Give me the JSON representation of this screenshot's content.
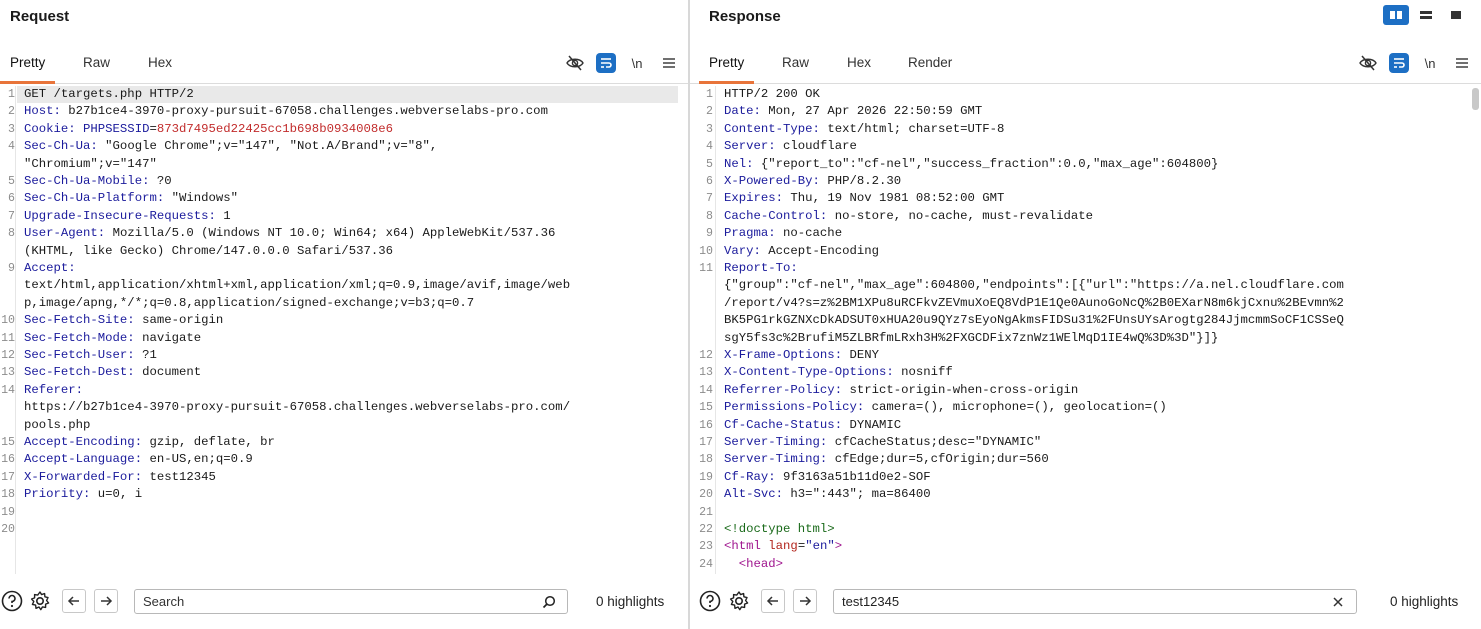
{
  "request": {
    "title": "Request",
    "tabs": [
      "Pretty",
      "Raw",
      "Hex"
    ],
    "tools": {
      "newline": "\\n"
    },
    "lines": [
      {
        "n": "1",
        "parts": [
          {
            "t": "GET /targets.php HTTP/2",
            "c": "hval"
          }
        ]
      },
      {
        "n": "2",
        "parts": [
          {
            "t": "Host:",
            "c": "hname"
          },
          {
            "t": " b27b1ce4-3970-proxy-pursuit-67058.challenges.webverselabs-pro.com",
            "c": "hval"
          }
        ]
      },
      {
        "n": "3",
        "parts": [
          {
            "t": "Cookie:",
            "c": "hname"
          },
          {
            "t": " PHPSESSID",
            "c": "hname"
          },
          {
            "t": "=",
            "c": "hval"
          },
          {
            "t": "873d7495ed22425cc1b698b0934008e6",
            "c": "cookval"
          }
        ]
      },
      {
        "n": "4",
        "parts": [
          {
            "t": "Sec-Ch-Ua:",
            "c": "hname"
          },
          {
            "t": " \"Google Chrome\";v=\"147\", \"Not.A/Brand\";v=\"8\",",
            "c": "hval"
          }
        ]
      },
      {
        "n": "",
        "parts": [
          {
            "t": "\"Chromium\";v=\"147\"",
            "c": "hval"
          }
        ]
      },
      {
        "n": "5",
        "parts": [
          {
            "t": "Sec-Ch-Ua-Mobile:",
            "c": "hname"
          },
          {
            "t": " ?0",
            "c": "hval"
          }
        ]
      },
      {
        "n": "6",
        "parts": [
          {
            "t": "Sec-Ch-Ua-Platform:",
            "c": "hname"
          },
          {
            "t": " \"Windows\"",
            "c": "hval"
          }
        ]
      },
      {
        "n": "7",
        "parts": [
          {
            "t": "Upgrade-Insecure-Requests:",
            "c": "hname"
          },
          {
            "t": " 1",
            "c": "hval"
          }
        ]
      },
      {
        "n": "8",
        "parts": [
          {
            "t": "User-Agent:",
            "c": "hname"
          },
          {
            "t": " Mozilla/5.0 (Windows NT 10.0; Win64; x64) AppleWebKit/537.36",
            "c": "hval"
          }
        ]
      },
      {
        "n": "",
        "parts": [
          {
            "t": "(KHTML, like Gecko) Chrome/147.0.0.0 Safari/537.36",
            "c": "hval"
          }
        ]
      },
      {
        "n": "9",
        "parts": [
          {
            "t": "Accept:",
            "c": "hname"
          }
        ]
      },
      {
        "n": "",
        "parts": [
          {
            "t": "text/html,application/xhtml+xml,application/xml;q=0.9,image/avif,image/web",
            "c": "hval"
          }
        ]
      },
      {
        "n": "",
        "parts": [
          {
            "t": "p,image/apng,*/*;q=0.8,application/signed-exchange;v=b3;q=0.7",
            "c": "hval"
          }
        ]
      },
      {
        "n": "10",
        "parts": [
          {
            "t": "Sec-Fetch-Site:",
            "c": "hname"
          },
          {
            "t": " same-origin",
            "c": "hval"
          }
        ]
      },
      {
        "n": "11",
        "parts": [
          {
            "t": "Sec-Fetch-Mode:",
            "c": "hname"
          },
          {
            "t": " navigate",
            "c": "hval"
          }
        ]
      },
      {
        "n": "12",
        "parts": [
          {
            "t": "Sec-Fetch-User:",
            "c": "hname"
          },
          {
            "t": " ?1",
            "c": "hval"
          }
        ]
      },
      {
        "n": "13",
        "parts": [
          {
            "t": "Sec-Fetch-Dest:",
            "c": "hname"
          },
          {
            "t": " document",
            "c": "hval"
          }
        ]
      },
      {
        "n": "14",
        "parts": [
          {
            "t": "Referer:",
            "c": "hname"
          }
        ]
      },
      {
        "n": "",
        "parts": [
          {
            "t": "https://b27b1ce4-3970-proxy-pursuit-67058.challenges.webverselabs-pro.com/",
            "c": "hval"
          }
        ]
      },
      {
        "n": "",
        "parts": [
          {
            "t": "pools.php",
            "c": "hval"
          }
        ]
      },
      {
        "n": "15",
        "parts": [
          {
            "t": "Accept-Encoding:",
            "c": "hname"
          },
          {
            "t": " gzip, deflate, br",
            "c": "hval"
          }
        ]
      },
      {
        "n": "16",
        "parts": [
          {
            "t": "Accept-Language:",
            "c": "hname"
          },
          {
            "t": " en-US,en;q=0.9",
            "c": "hval"
          }
        ]
      },
      {
        "n": "17",
        "parts": [
          {
            "t": "X-Forwarded-For:",
            "c": "hname"
          },
          {
            "t": " test12345",
            "c": "hval"
          }
        ]
      },
      {
        "n": "18",
        "parts": [
          {
            "t": "Priority:",
            "c": "hname"
          },
          {
            "t": " u=0, i",
            "c": "hval"
          }
        ]
      },
      {
        "n": "19",
        "parts": []
      },
      {
        "n": "20",
        "parts": []
      }
    ],
    "search": {
      "value": "",
      "placeholder": "Search"
    },
    "highlights": "0 highlights"
  },
  "response": {
    "title": "Response",
    "tabs": [
      "Pretty",
      "Raw",
      "Hex",
      "Render"
    ],
    "tools": {
      "newline": "\\n"
    },
    "lines": [
      {
        "n": "1",
        "parts": [
          {
            "t": "HTTP/2 200 OK",
            "c": "hval"
          }
        ]
      },
      {
        "n": "2",
        "parts": [
          {
            "t": "Date:",
            "c": "hname"
          },
          {
            "t": " Mon, 27 Apr 2026 22:50:59 GMT",
            "c": "hval"
          }
        ]
      },
      {
        "n": "3",
        "parts": [
          {
            "t": "Content-Type:",
            "c": "hname"
          },
          {
            "t": " text/html; charset=UTF-8",
            "c": "hval"
          }
        ]
      },
      {
        "n": "4",
        "parts": [
          {
            "t": "Server:",
            "c": "hname"
          },
          {
            "t": " cloudflare",
            "c": "hval"
          }
        ]
      },
      {
        "n": "5",
        "parts": [
          {
            "t": "Nel:",
            "c": "hname"
          },
          {
            "t": " {\"report_to\":\"cf-nel\",\"success_fraction\":0.0,\"max_age\":604800}",
            "c": "hval"
          }
        ]
      },
      {
        "n": "6",
        "parts": [
          {
            "t": "X-Powered-By:",
            "c": "hname"
          },
          {
            "t": " PHP/8.2.30",
            "c": "hval"
          }
        ]
      },
      {
        "n": "7",
        "parts": [
          {
            "t": "Expires:",
            "c": "hname"
          },
          {
            "t": " Thu, 19 Nov 1981 08:52:00 GMT",
            "c": "hval"
          }
        ]
      },
      {
        "n": "8",
        "parts": [
          {
            "t": "Cache-Control:",
            "c": "hname"
          },
          {
            "t": " no-store, no-cache, must-revalidate",
            "c": "hval"
          }
        ]
      },
      {
        "n": "9",
        "parts": [
          {
            "t": "Pragma:",
            "c": "hname"
          },
          {
            "t": " no-cache",
            "c": "hval"
          }
        ]
      },
      {
        "n": "10",
        "parts": [
          {
            "t": "Vary:",
            "c": "hname"
          },
          {
            "t": " Accept-Encoding",
            "c": "hval"
          }
        ]
      },
      {
        "n": "11",
        "parts": [
          {
            "t": "Report-To:",
            "c": "hname"
          }
        ]
      },
      {
        "n": "",
        "parts": [
          {
            "t": "{\"group\":\"cf-nel\",\"max_age\":604800,\"endpoints\":[{\"url\":\"https://a.nel.cloudflare.com",
            "c": "hval"
          }
        ]
      },
      {
        "n": "",
        "parts": [
          {
            "t": "/report/v4?s=z%2BM1XPu8uRCFkvZEVmuXoEQ8VdP1E1Qe0AunoGoNcQ%2B0EXarN8m6kjCxnu%2BEvmn%2",
            "c": "hval"
          }
        ]
      },
      {
        "n": "",
        "parts": [
          {
            "t": "BK5PG1rkGZNXcDkADSUT0xHUA20u9QYz7sEyoNgAkmsFIDSu31%2FUnsUYsArogtg284JjmcmmSoCF1CSSeQ",
            "c": "hval"
          }
        ]
      },
      {
        "n": "",
        "parts": [
          {
            "t": "sgY5fs3c%2BrufiM5ZLBRfmLRxh3H%2FXGCDFix7znWz1WElMqD1IE4wQ%3D%3D\"}]}",
            "c": "hval"
          }
        ]
      },
      {
        "n": "12",
        "parts": [
          {
            "t": "X-Frame-Options:",
            "c": "hname"
          },
          {
            "t": " DENY",
            "c": "hval"
          }
        ]
      },
      {
        "n": "13",
        "parts": [
          {
            "t": "X-Content-Type-Options:",
            "c": "hname"
          },
          {
            "t": " nosniff",
            "c": "hval"
          }
        ]
      },
      {
        "n": "14",
        "parts": [
          {
            "t": "Referrer-Policy:",
            "c": "hname"
          },
          {
            "t": " strict-origin-when-cross-origin",
            "c": "hval"
          }
        ]
      },
      {
        "n": "15",
        "parts": [
          {
            "t": "Permissions-Policy:",
            "c": "hname"
          },
          {
            "t": " camera=(), microphone=(), geolocation=()",
            "c": "hval"
          }
        ]
      },
      {
        "n": "16",
        "parts": [
          {
            "t": "Cf-Cache-Status:",
            "c": "hname"
          },
          {
            "t": " DYNAMIC",
            "c": "hval"
          }
        ]
      },
      {
        "n": "17",
        "parts": [
          {
            "t": "Server-Timing:",
            "c": "hname"
          },
          {
            "t": " cfCacheStatus;desc=\"DYNAMIC\"",
            "c": "hval"
          }
        ]
      },
      {
        "n": "18",
        "parts": [
          {
            "t": "Server-Timing:",
            "c": "hname"
          },
          {
            "t": " cfEdge;dur=5,cfOrigin;dur=560",
            "c": "hval"
          }
        ]
      },
      {
        "n": "19",
        "parts": [
          {
            "t": "Cf-Ray:",
            "c": "hname"
          },
          {
            "t": " 9f3163a51b11d0e2-SOF",
            "c": "hval"
          }
        ]
      },
      {
        "n": "20",
        "parts": [
          {
            "t": "Alt-Svc:",
            "c": "hname"
          },
          {
            "t": " h3=\":443\"; ma=86400",
            "c": "hval"
          }
        ]
      },
      {
        "n": "21",
        "parts": []
      },
      {
        "n": "22",
        "parts": [
          {
            "t": "<!doctype html>",
            "c": "doctype"
          }
        ]
      },
      {
        "n": "23",
        "parts": [
          {
            "t": "<html",
            "c": "tagc"
          },
          {
            "t": " lang",
            "c": "attr"
          },
          {
            "t": "=",
            "c": "hval"
          },
          {
            "t": "\"en\"",
            "c": "str"
          },
          {
            "t": ">",
            "c": "tagc"
          }
        ]
      },
      {
        "n": "24",
        "parts": [
          {
            "t": "  <head>",
            "c": "tagc"
          }
        ]
      }
    ],
    "search": {
      "value": "test12345",
      "placeholder": ""
    },
    "highlights": "0 highlights"
  },
  "colors": {
    "accent": "#1d6fc4",
    "active_tab": "#e8743a",
    "header_name": "#1b1b9c",
    "cookie_value": "#c22c2c"
  },
  "icons": [
    "help-icon",
    "settings-icon",
    "arrow-left-icon",
    "arrow-right-icon",
    "search-icon",
    "clear-icon",
    "eye-off-icon",
    "wrap-icon",
    "menu-icon",
    "layout-split-icon",
    "layout-horizontal-icon",
    "layout-single-icon"
  ]
}
